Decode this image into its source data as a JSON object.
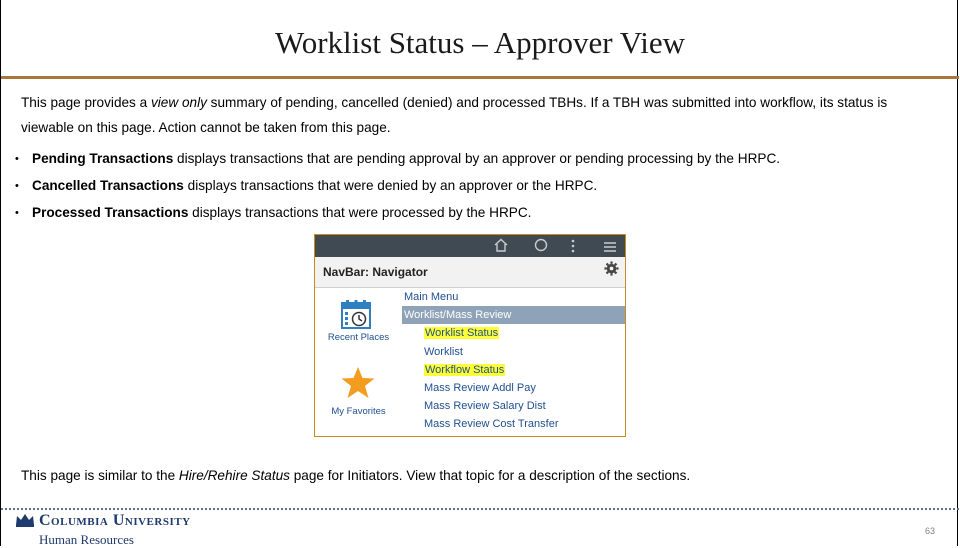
{
  "slide": {
    "title": "Worklist Status – Approver View",
    "intro": {
      "part1": "This page provides a ",
      "italic": "view only",
      "part2": " summary of pending, cancelled (denied) and processed TBHs. If a TBH was submitted into workflow, its status is viewable on this page. Action cannot be taken from this page."
    },
    "bullets": [
      {
        "bold": "Pending Transactions",
        "text": " displays transactions that are pending approval by an approver or pending processing by the HRPC."
      },
      {
        "bold": "Cancelled Transactions",
        "text": " displays transactions that were denied by an approver or the HRPC."
      },
      {
        "bold": "Processed Transactions",
        "text": " displays transactions that were processed by the HRPC."
      }
    ],
    "note": {
      "part1": "This page is similar to the ",
      "italic": "Hire/Rehire Status",
      "part2": " page for Initiators. View that topic for a description of the sections."
    },
    "footer": {
      "university": "Columbia University",
      "department": "Human Resources",
      "page_number": "63"
    }
  },
  "navigator": {
    "top_icons": [
      "home-icon",
      "search-icon",
      "more-icon",
      "menu-icon"
    ],
    "title": "NavBar: Navigator",
    "left": {
      "recent_places": "Recent Places",
      "my_favorites": "My Favorites"
    },
    "menu": [
      {
        "label": "Main Menu",
        "level": 1,
        "selected": false,
        "highlight": false
      },
      {
        "label": "Worklist/Mass Review",
        "level": 1,
        "selected": true,
        "highlight": false
      },
      {
        "label": "Worklist Status",
        "level": 2,
        "selected": false,
        "highlight": true
      },
      {
        "label": "Worklist",
        "level": 2,
        "selected": false,
        "highlight": false
      },
      {
        "label": "Workflow Status",
        "level": 2,
        "selected": false,
        "highlight": true
      },
      {
        "label": "Mass Review Addl Pay",
        "level": 2,
        "selected": false,
        "highlight": false
      },
      {
        "label": "Mass Review Salary Dist",
        "level": 2,
        "selected": false,
        "highlight": false
      },
      {
        "label": "Mass Review Cost Transfer",
        "level": 2,
        "selected": false,
        "highlight": false
      }
    ],
    "colors": {
      "topbar": "#3f4a52",
      "selected": "#8ea3b8",
      "highlight": "#ffff38",
      "link": "#1f4f8e",
      "border": "#c98c1c",
      "star": "#f39c1f"
    }
  }
}
